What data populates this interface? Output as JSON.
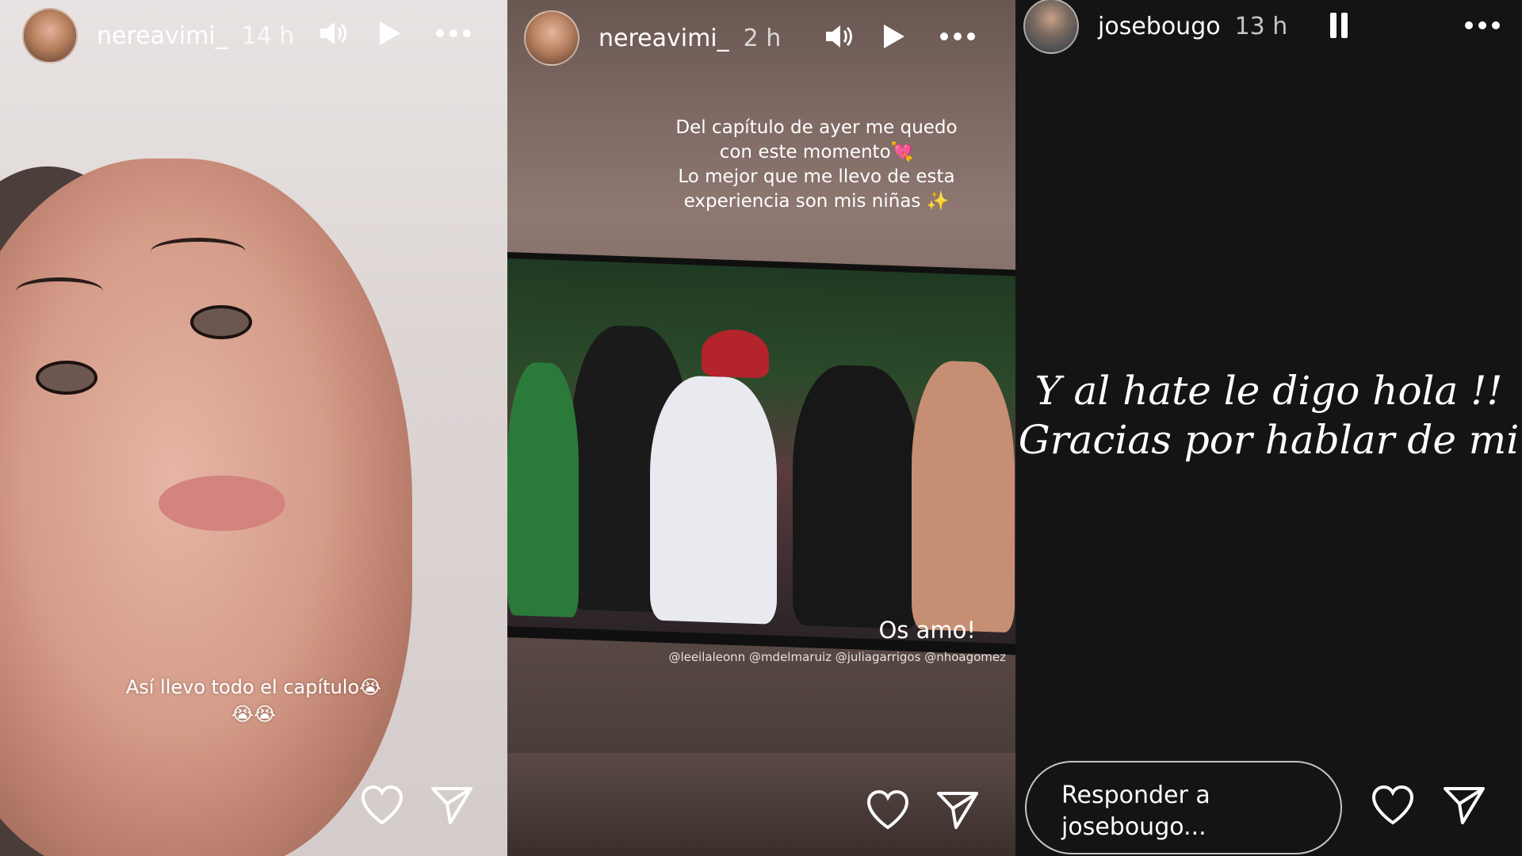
{
  "stories": [
    {
      "username": "nereavimi_",
      "time": "14 h",
      "caption_line1": "Así llevo todo el capítulo😭",
      "caption_line2": "😭😭"
    },
    {
      "username": "nereavimi_",
      "time": "2 h",
      "caption_lines": [
        "Del capítulo de ayer me quedo",
        "con este momento💘",
        "Lo mejor que me llevo de esta",
        "experiencia son mis niñas ✨"
      ],
      "tv_text": "Os amo!",
      "mentions": "@leeilaleonn @mdelmaruiz @juliagarrigos @nhoagomez"
    },
    {
      "username": "josebougo",
      "time": "13 h",
      "quote_line1": "Y al hate le digo hola !!",
      "quote_line2": "Gracias por hablar de mi",
      "reply_placeholder": "Responder a josebougo..."
    }
  ],
  "icons": {
    "sound": "speaker-icon",
    "play": "play-icon",
    "pause": "pause-icon",
    "more": "more-icon",
    "like": "heart-icon",
    "share": "send-icon"
  }
}
